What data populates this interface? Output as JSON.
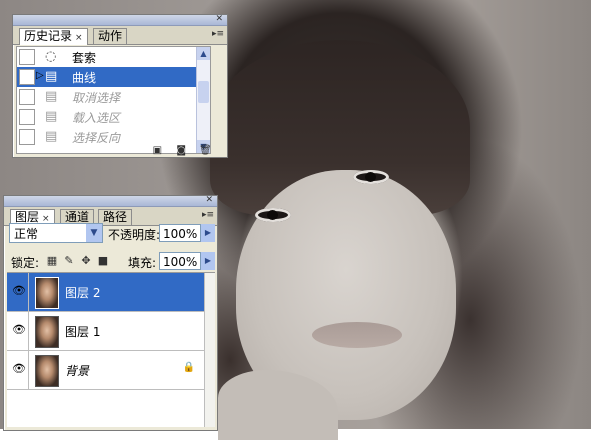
{
  "history_panel": {
    "tabs": [
      {
        "label": "历史记录",
        "active": true,
        "close": "×"
      },
      {
        "label": "动作",
        "active": false
      }
    ],
    "menu_icon": "panel-menu-icon",
    "items": [
      {
        "label": "套索",
        "icon": "lasso-icon",
        "state": "normal"
      },
      {
        "label": "曲线",
        "icon": "history-state-icon",
        "state": "selected"
      },
      {
        "label": "取消选择",
        "icon": "history-state-icon",
        "state": "dimmed"
      },
      {
        "label": "载入选区",
        "icon": "history-state-icon",
        "state": "dimmed"
      },
      {
        "label": "选择反向",
        "icon": "history-state-icon",
        "state": "dimmed"
      }
    ],
    "footer_icons": [
      "new-document-from-state-icon",
      "snapshot-camera-icon",
      "trash-icon"
    ]
  },
  "layers_panel": {
    "tabs": [
      {
        "label": "图层",
        "active": true,
        "close": "×"
      },
      {
        "label": "通道",
        "active": false
      },
      {
        "label": "路径",
        "active": false
      }
    ],
    "blend_mode": "正常",
    "opacity_label": "不透明度:",
    "opacity_value": "100%",
    "lock_label": "锁定:",
    "fill_label": "填充:",
    "fill_value": "100%",
    "layers": [
      {
        "name": "图层 2",
        "visible": true,
        "selected": true,
        "locked": false
      },
      {
        "name": "图层 1",
        "visible": true,
        "selected": false,
        "locked": false
      },
      {
        "name": "背景",
        "visible": true,
        "selected": false,
        "locked": true
      }
    ]
  },
  "colors": {
    "selection": "#316ac5",
    "panel_bg": "#ece9d8"
  }
}
